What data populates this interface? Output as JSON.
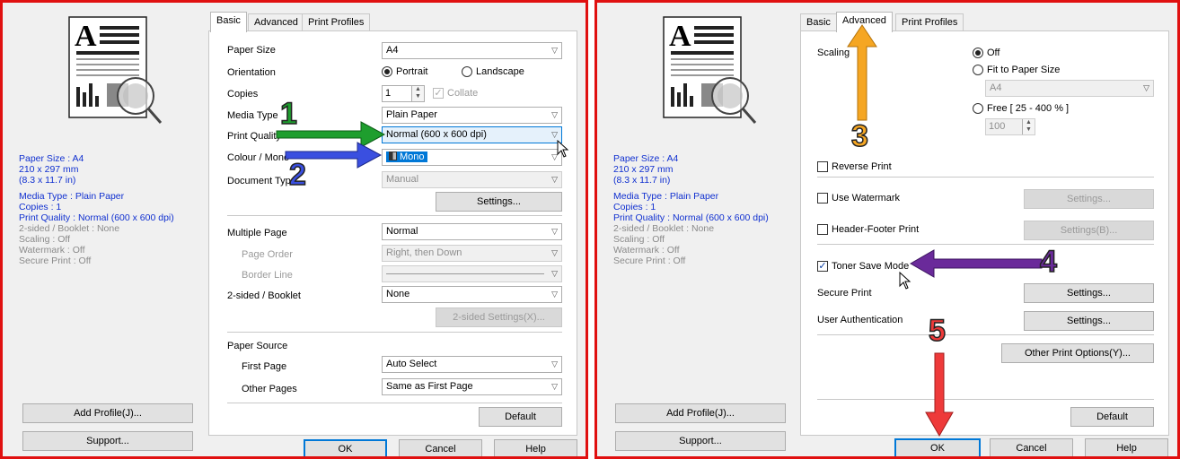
{
  "side": {
    "paper_size": "Paper Size : A4",
    "dim_mm": "210 x 297 mm",
    "dim_in": "(8.3 x 11.7 in)",
    "media_type": "Media Type : Plain Paper",
    "copies": "Copies : 1",
    "print_quality": "Print Quality : Normal (600 x 600 dpi)",
    "two_sided": "2-sided / Booklet : None",
    "scaling": "Scaling : Off",
    "watermark": "Watermark : Off",
    "secure_print": "Secure Print : Off",
    "add_profile": "Add Profile(J)...",
    "support": "Support..."
  },
  "tabs": {
    "basic": "Basic",
    "advanced": "Advanced",
    "profiles": "Print Profiles"
  },
  "basic": {
    "paper_size_label": "Paper Size",
    "paper_size_value": "A4",
    "orientation_label": "Orientation",
    "portrait": "Portrait",
    "landscape": "Landscape",
    "copies_label": "Copies",
    "copies_value": "1",
    "collate": "Collate",
    "media_type_label": "Media Type",
    "media_type_value": "Plain Paper",
    "print_quality_label": "Print Quality",
    "print_quality_value": "Normal (600 x 600 dpi)",
    "colour_label": "Colour / Mono",
    "colour_value": "Mono",
    "doc_type_label": "Document Type",
    "doc_type_value": "Manual",
    "settings": "Settings...",
    "multiple_page_label": "Multiple Page",
    "multiple_page_value": "Normal",
    "page_order_label": "Page Order",
    "page_order_value": "Right, then Down",
    "border_line_label": "Border Line",
    "two_sided_label": "2-sided / Booklet",
    "two_sided_value": "None",
    "two_sided_settings": "2-sided Settings(X)...",
    "paper_source_label": "Paper Source",
    "first_page_label": "First Page",
    "first_page_value": "Auto Select",
    "other_pages_label": "Other Pages",
    "other_pages_value": "Same as First Page",
    "default": "Default"
  },
  "advanced": {
    "scaling_label": "Scaling",
    "off": "Off",
    "fit": "Fit to Paper Size",
    "fit_value": "A4",
    "free": "Free [ 25 - 400 % ]",
    "free_value": "100",
    "reverse_print": "Reverse Print",
    "use_watermark": "Use Watermark",
    "watermark_settings": "Settings...",
    "header_footer": "Header-Footer Print",
    "header_footer_settings": "Settings(B)...",
    "toner_save": "Toner Save Mode",
    "secure_print": "Secure Print",
    "secure_settings": "Settings...",
    "user_auth": "User Authentication",
    "user_auth_settings": "Settings...",
    "other_options": "Other Print Options(Y)...",
    "default": "Default"
  },
  "footer": {
    "ok": "OK",
    "cancel": "Cancel",
    "help": "Help"
  },
  "annotations": {
    "n1": "1",
    "n2": "2",
    "n3": "3",
    "n4": "4",
    "n5": "5",
    "colors": {
      "green": "#1e9e2e",
      "blue": "#3a4fe0",
      "orange": "#f5a623",
      "purple": "#6a2a9a",
      "red": "#ee3a3a",
      "frame": "#e01010"
    }
  }
}
